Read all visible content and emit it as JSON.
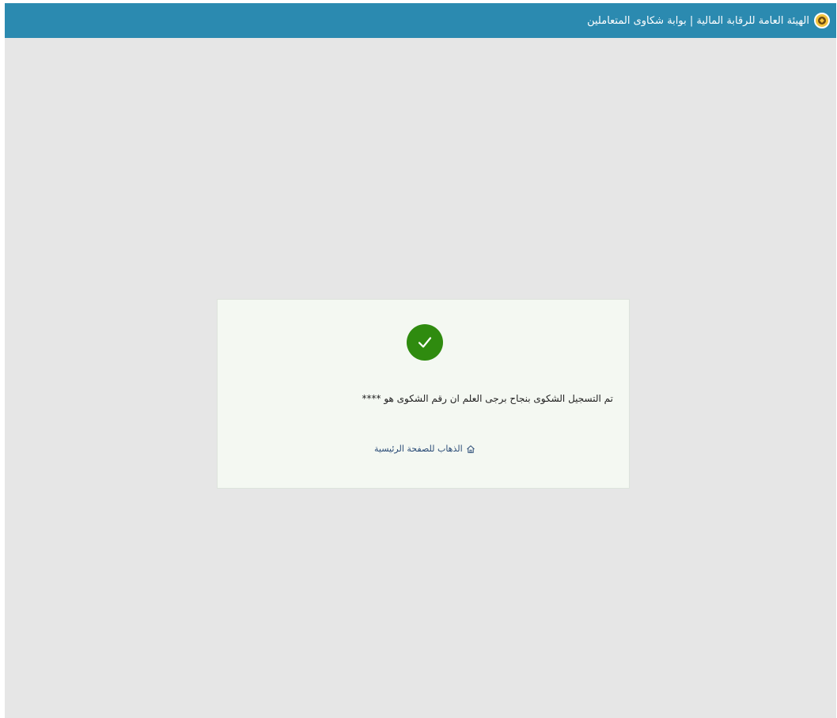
{
  "header": {
    "title": "الهيئة العامة للرقابة المالية | بوابة شكاوى المتعاملين",
    "logo_icon": "authority-seal-icon",
    "background_color": "#2b8ab0"
  },
  "confirmation": {
    "status_icon": "checkmark-icon",
    "status_color": "#2f8b0f",
    "message": "تم التسجيل الشكوى بنجاح برجى العلم ان رقم الشكوى هو ****",
    "home_link_label": "الذهاب للصفحة الرئيسية",
    "home_link_icon": "home-icon"
  }
}
